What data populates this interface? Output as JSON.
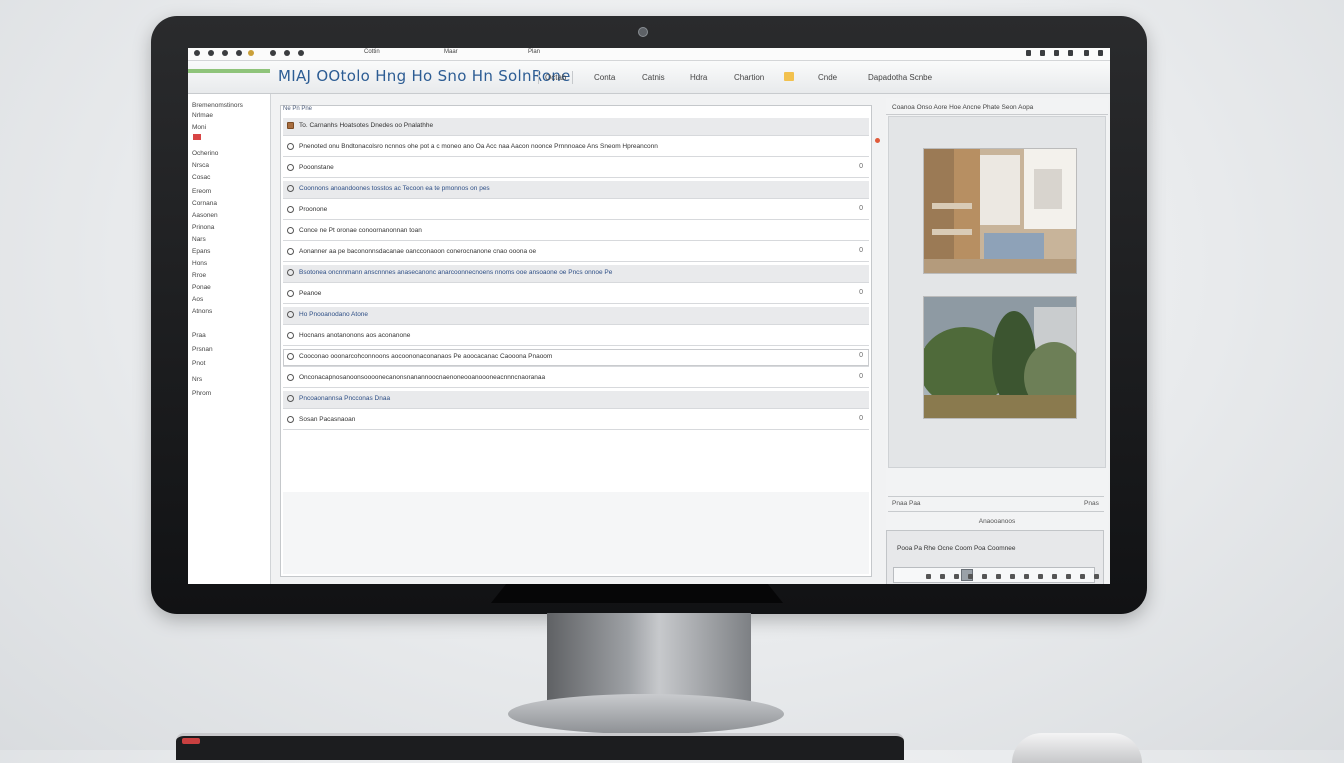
{
  "app": {
    "title": "MIAJ  OOtolo Hng  Ho  Sno  Hn  SolnRone"
  },
  "menubar": {
    "left_labels": [
      "Cottin",
      "Maar",
      "Plan"
    ],
    "right_labels": []
  },
  "toolbar": {
    "tabs": [
      {
        "label": "Octab"
      },
      {
        "label": "Conta"
      },
      {
        "label": "Catnis"
      },
      {
        "label": "Hdra"
      },
      {
        "label": "Chartion"
      },
      {
        "label": "Cnde"
      },
      {
        "label": "Dapadotha Scnbe"
      }
    ]
  },
  "sidebar": {
    "items": [
      "Bremenomstinors",
      "Nrlmae",
      "Moni",
      "Ocherino",
      "Nrsca",
      "Cosac",
      "Ereom",
      "Cornana",
      "Aasonen",
      "Prinona",
      "Nars",
      "Epans",
      "Hons",
      "Rroe",
      "Ponae",
      "Aos",
      "Atnons",
      "Praa",
      "Prsnan",
      "Pnot",
      "Nrs",
      "Phrom"
    ]
  },
  "main": {
    "header": "Ne  Pn  Pne",
    "rows": [
      {
        "text": "To. Carnanhs Hoatsotes Dnedes oo Pnalathhe",
        "end": "",
        "style": "gray"
      },
      {
        "text": "Pnenoted  onu  Bndtonacolsro  ncnnos  ohe  pot a c moneo  ano  Oa  Acc naa  Aacon noonce  Prnnnoace  Ans  Sneom  Hpreanconn",
        "end": "",
        "style": ""
      },
      {
        "text": "Pooonstane",
        "end": "0",
        "style": ""
      },
      {
        "text": "Coonnons anoandoones  tosstos  ac  Tecoon  ea  te  pmonnos  on pes",
        "end": "",
        "style": "gray"
      },
      {
        "text": "Proonone",
        "end": "0",
        "style": ""
      },
      {
        "text": "Conce ne  Pt  oronae conoornanonnan  toan",
        "end": "",
        "style": ""
      },
      {
        "text": "Aonanner  aa  pe  bacononnsdacanae  oancconaoon  conerocnanone  cnao  ooona  oe",
        "end": "0",
        "style": ""
      },
      {
        "text": "Bsotonea  oncnnmann  anscnnnes  anasecanonc  anarcoonnecnoens  nnoms  ooe  ansoaone  oe  Pncs  onnoe  Pe",
        "end": "",
        "style": "gray"
      },
      {
        "text": "Peanoe",
        "end": "0",
        "style": ""
      },
      {
        "text": "Ho Pnooanodano Atone",
        "end": "",
        "style": "gray"
      },
      {
        "text": "Hocnans anotanonons aos  aconanone",
        "end": "",
        "style": ""
      },
      {
        "text": "Cooconao  ooonarcohconnoons  aocoononaconanaos  Pe  aoocacanac  Caooona  Pnaoom",
        "end": "0",
        "style": "shadow"
      },
      {
        "text": "Onconacapnosanoonsoooonecanonsnanannoocnaenoneooanoooneacnnncnaoranaa",
        "end": "0",
        "style": ""
      },
      {
        "text": "Pncoaonannsa  Pncconas  Dnaa",
        "end": "",
        "style": "gray"
      },
      {
        "text": "Sosan  Pacasnaoan",
        "end": "0",
        "style": ""
      }
    ]
  },
  "right_panel": {
    "header": "Coanoa  Onso  Aore  Hoe  Ancne  Phate  Seon  Aopa",
    "caption_left": "Pnaa  Paa",
    "caption_right": "Pnas",
    "center_caption": "Anaooanoos",
    "info_line": "Pooa  Pa  Rhe  Ocne  Coom  Poa  Coomnee",
    "photo1_name": "workshop-image",
    "photo2_name": "landscape-image"
  },
  "colors": {
    "accent": "#2d5d94",
    "logo_green": "#8fc47a",
    "alert_red": "#d84545"
  }
}
